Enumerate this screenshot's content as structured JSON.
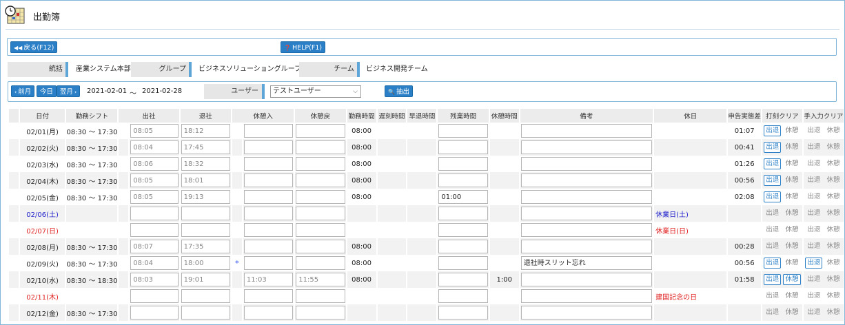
{
  "app": {
    "title": "出勤簿",
    "icon": "attendance-calendar-clock-icon"
  },
  "toolbar": {
    "back_label": "戻る(F12)",
    "help_label": "HELP(F1)"
  },
  "org": [
    {
      "label": "統括",
      "value": "産業システム本部"
    },
    {
      "label": "グループ",
      "value": "ビジネスソリューショングループ"
    },
    {
      "label": "チーム",
      "value": "ビジネス開発チーム"
    }
  ],
  "nav": {
    "prev_label": "前月",
    "today_label": "今日",
    "next_label": "翌月",
    "start_date": "2021-02-01",
    "tilde": "～",
    "end_date": "2021-02-28",
    "user_label": "ユーザー",
    "user_value": "テストユーザー",
    "extract_label": "抽出"
  },
  "table": {
    "headers": [
      "日付",
      "勤務シフト",
      "出社",
      "退社",
      "休憩入",
      "休憩戻",
      "勤務時間",
      "遅刻時間",
      "早退時間",
      "残業時間",
      "休憩時間",
      "備考",
      "休日",
      "申告実態差",
      "打刻クリア",
      "手入力クリア"
    ],
    "rows": [
      {
        "date": "02/01(月)",
        "shift": "08:30 ～ 17:30",
        "in": "08:05",
        "out": "18:12",
        "br_in": "",
        "br_out": "",
        "work": "08:00",
        "late": "",
        "early": "",
        "ot": "",
        "br_time": "",
        "note": "",
        "holiday": "",
        "diff": "01:07",
        "c1": "出退",
        "c2": "休憩",
        "c3": "出退",
        "c4": "休憩",
        "c1on": true,
        "c2on": false,
        "c3on": false,
        "c4on": false,
        "day": "weekday",
        "mark": ""
      },
      {
        "date": "02/02(火)",
        "shift": "08:30 ～ 17:30",
        "in": "08:04",
        "out": "17:45",
        "br_in": "",
        "br_out": "",
        "work": "08:00",
        "late": "",
        "early": "",
        "ot": "",
        "br_time": "",
        "note": "",
        "holiday": "",
        "diff": "00:41",
        "c1": "出退",
        "c2": "休憩",
        "c3": "出退",
        "c4": "休憩",
        "c1on": true,
        "c2on": false,
        "c3on": false,
        "c4on": false,
        "day": "weekday",
        "mark": ""
      },
      {
        "date": "02/03(水)",
        "shift": "08:30 ～ 17:30",
        "in": "08:06",
        "out": "18:32",
        "br_in": "",
        "br_out": "",
        "work": "08:00",
        "late": "",
        "early": "",
        "ot": "",
        "br_time": "",
        "note": "",
        "holiday": "",
        "diff": "01:26",
        "c1": "出退",
        "c2": "休憩",
        "c3": "出退",
        "c4": "休憩",
        "c1on": true,
        "c2on": false,
        "c3on": false,
        "c4on": false,
        "day": "weekday",
        "mark": ""
      },
      {
        "date": "02/04(木)",
        "shift": "08:30 ～ 17:30",
        "in": "08:05",
        "out": "18:01",
        "br_in": "",
        "br_out": "",
        "work": "08:00",
        "late": "",
        "early": "",
        "ot": "",
        "br_time": "",
        "note": "",
        "holiday": "",
        "diff": "00:56",
        "c1": "出退",
        "c2": "休憩",
        "c3": "出退",
        "c4": "休憩",
        "c1on": true,
        "c2on": false,
        "c3on": false,
        "c4on": false,
        "day": "weekday",
        "mark": ""
      },
      {
        "date": "02/05(金)",
        "shift": "08:30 ～ 17:30",
        "in": "08:05",
        "out": "19:13",
        "br_in": "",
        "br_out": "",
        "work": "08:00",
        "late": "",
        "early": "",
        "ot": "01:00",
        "br_time": "",
        "note": "",
        "holiday": "",
        "diff": "02:08",
        "c1": "出退",
        "c2": "休憩",
        "c3": "出退",
        "c4": "休憩",
        "c1on": true,
        "c2on": false,
        "c3on": false,
        "c4on": false,
        "day": "weekday",
        "mark": ""
      },
      {
        "date": "02/06(土)",
        "shift": "",
        "in": "",
        "out": "",
        "br_in": "",
        "br_out": "",
        "work": "",
        "late": "",
        "early": "",
        "ot": "",
        "br_time": "",
        "note": "",
        "holiday": "休業日(土)",
        "diff": "",
        "c1": "出退",
        "c2": "休憩",
        "c3": "出退",
        "c4": "休憩",
        "c1on": false,
        "c2on": false,
        "c3on": false,
        "c4on": false,
        "day": "sat",
        "mark": ""
      },
      {
        "date": "02/07(日)",
        "shift": "",
        "in": "",
        "out": "",
        "br_in": "",
        "br_out": "",
        "work": "",
        "late": "",
        "early": "",
        "ot": "",
        "br_time": "",
        "note": "",
        "holiday": "休業日(日)",
        "diff": "",
        "c1": "出退",
        "c2": "休憩",
        "c3": "出退",
        "c4": "休憩",
        "c1on": false,
        "c2on": false,
        "c3on": false,
        "c4on": false,
        "day": "sun",
        "mark": ""
      },
      {
        "date": "02/08(月)",
        "shift": "08:30 ～ 17:30",
        "in": "08:07",
        "out": "17:35",
        "br_in": "",
        "br_out": "",
        "work": "08:00",
        "late": "",
        "early": "",
        "ot": "",
        "br_time": "",
        "note": "",
        "holiday": "",
        "diff": "00:28",
        "c1": "出退",
        "c2": "休憩",
        "c3": "出退",
        "c4": "休憩",
        "c1on": false,
        "c2on": false,
        "c3on": false,
        "c4on": false,
        "day": "weekday",
        "mark": ""
      },
      {
        "date": "02/09(火)",
        "shift": "08:30 ～ 17:30",
        "in": "08:04",
        "out": "18:00",
        "br_in": "",
        "br_out": "",
        "work": "08:00",
        "late": "",
        "early": "",
        "ot": "",
        "br_time": "",
        "note": "退社時スリット忘れ",
        "holiday": "",
        "diff": "00:56",
        "c1": "出退",
        "c2": "休憩",
        "c3": "出退",
        "c4": "休憩",
        "c1on": true,
        "c2on": false,
        "c3on": true,
        "c4on": false,
        "day": "weekday",
        "mark": "*"
      },
      {
        "date": "02/10(水)",
        "shift": "08:30 ～ 18:30",
        "in": "08:03",
        "out": "19:01",
        "br_in": "11:03",
        "br_out": "11:55",
        "work": "08:00",
        "late": "",
        "early": "",
        "ot": "",
        "br_time": "1:00",
        "note": "",
        "holiday": "",
        "diff": "01:58",
        "c1": "出退",
        "c2": "休憩",
        "c3": "出退",
        "c4": "休憩",
        "c1on": true,
        "c2on": true,
        "c3on": false,
        "c4on": false,
        "day": "weekday",
        "mark": ""
      },
      {
        "date": "02/11(木)",
        "shift": "",
        "in": "",
        "out": "",
        "br_in": "",
        "br_out": "",
        "work": "",
        "late": "",
        "early": "",
        "ot": "",
        "br_time": "",
        "note": "",
        "holiday": "建国記念の日",
        "diff": "",
        "c1": "出退",
        "c2": "休憩",
        "c3": "出退",
        "c4": "休憩",
        "c1on": false,
        "c2on": false,
        "c3on": false,
        "c4on": false,
        "day": "sun",
        "mark": ""
      },
      {
        "date": "02/12(金)",
        "shift": "08:30 ～ 17:30",
        "in": "",
        "out": "",
        "br_in": "",
        "br_out": "",
        "work": "",
        "late": "",
        "early": "",
        "ot": "",
        "br_time": "",
        "note": "",
        "holiday": "",
        "diff": "",
        "c1": "出退",
        "c2": "休憩",
        "c3": "出退",
        "c4": "休憩",
        "c1on": false,
        "c2on": false,
        "c3on": false,
        "c4on": false,
        "day": "weekday",
        "mark": ""
      }
    ]
  },
  "colors": {
    "accent": "#2a7fc6",
    "saturday": "#2222cc",
    "holiday": "#e02020"
  }
}
